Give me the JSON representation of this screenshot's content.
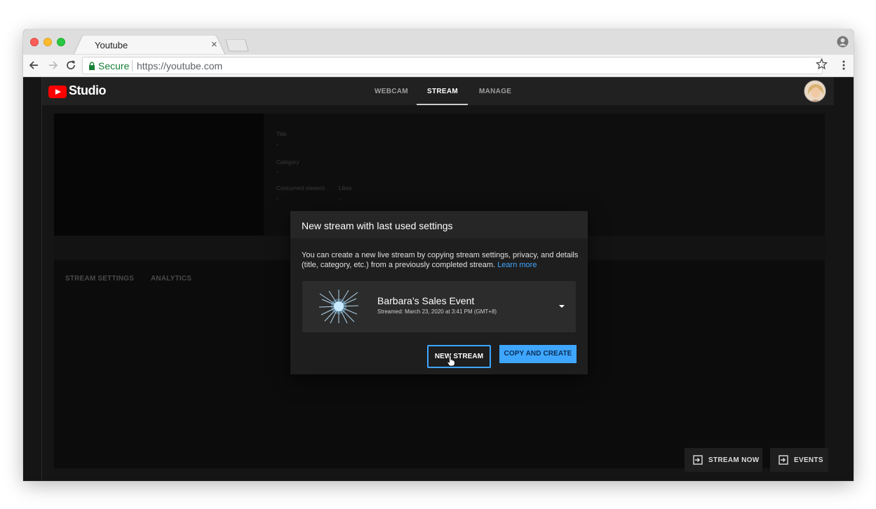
{
  "browser": {
    "tab_title": "Youtube",
    "tab_close": "×",
    "secure_label": "Secure",
    "url": "https://youtube.com"
  },
  "studio": {
    "logo_text": "Studio",
    "nav": [
      {
        "label": "WEBCAM",
        "active": false
      },
      {
        "label": "STREAM",
        "active": true
      },
      {
        "label": "MANAGE",
        "active": false
      }
    ]
  },
  "info": {
    "title_label": "Title",
    "title_value": "-",
    "category_label": "Category",
    "category_value": "-",
    "viewers_label": "Concurrent viewers",
    "viewers_value": "-",
    "likes_label": "Likes",
    "likes_value": "-"
  },
  "lower_tabs": [
    "STREAM SETTINGS",
    "ANALYTICS"
  ],
  "actions": {
    "stream_now": "STREAM NOW",
    "events": "EVENTS"
  },
  "dialog": {
    "title": "New stream with last used settings",
    "body": "You can create a new live stream by copying stream settings, privacy, and details (title, category, etc.) from a previously completed stream.",
    "learn_more": "Learn more",
    "selected_stream": {
      "name": "Barbara’s Sales Event",
      "date": "Streamed: March 23, 2020 at 3:41 PM (GMT+8)"
    },
    "new_stream_button": "NEW STREAM",
    "copy_button": "COPY AND CREATE"
  },
  "colors": {
    "accent": "#3ea6ff",
    "youtube_red": "#ff0000",
    "secure_green": "#188038"
  },
  "icons": [
    "back-icon",
    "forward-icon",
    "reload-icon",
    "lock-icon",
    "star-icon",
    "kebab-menu-icon",
    "profile-icon",
    "youtube-play-icon",
    "dropdown-caret-icon",
    "stream-now-icon",
    "events-icon",
    "hand-cursor-icon"
  ]
}
